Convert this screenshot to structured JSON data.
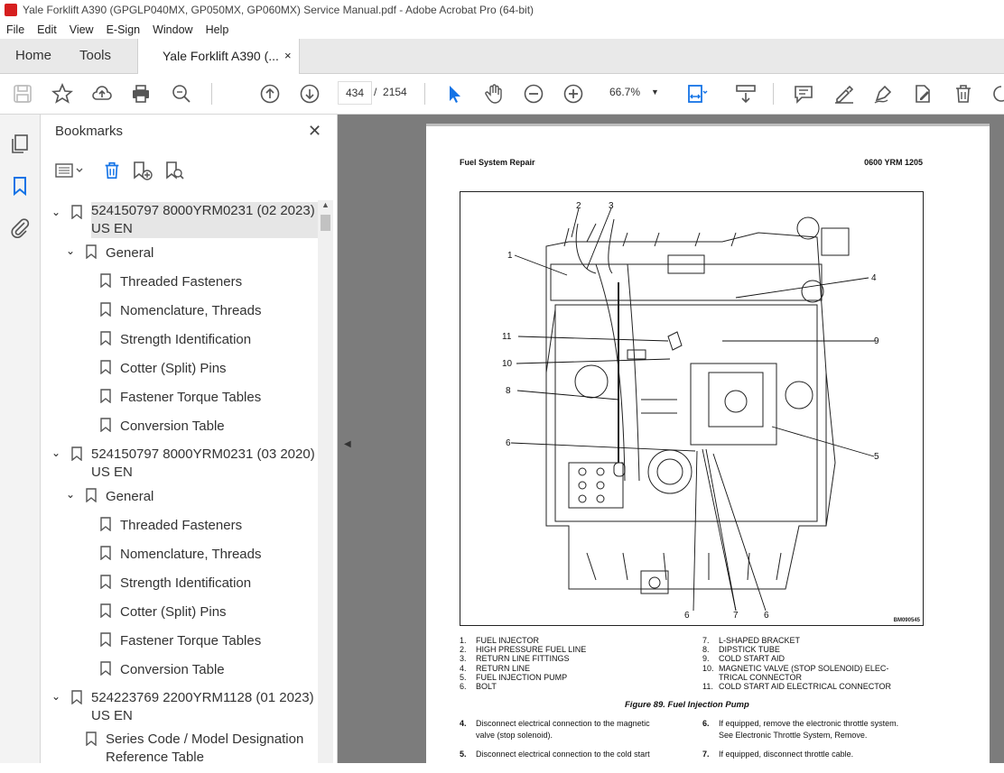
{
  "window": {
    "title": "Yale Forklift A390 (GPGLP040MX, GP050MX, GP060MX) Service Manual.pdf - Adobe Acrobat Pro (64-bit)"
  },
  "menu": [
    "File",
    "Edit",
    "View",
    "E-Sign",
    "Window",
    "Help"
  ],
  "tabs": {
    "home": "Home",
    "tools": "Tools",
    "document": "Yale Forklift A390 (...",
    "close": "×"
  },
  "toolbar": {
    "current_page": "434",
    "page_separator": "/",
    "total_pages": "2154",
    "zoom": "66.7%"
  },
  "bookmarks": {
    "title": "Bookmarks",
    "items": [
      {
        "label": "524150797 8000YRM0231 (02 2023)",
        "label2": "US EN",
        "level": 0
      },
      {
        "label": "General",
        "level": 1
      },
      {
        "label": "Threaded Fasteners",
        "level": 2
      },
      {
        "label": "Nomenclature, Threads",
        "level": 2
      },
      {
        "label": "Strength Identification",
        "level": 2
      },
      {
        "label": "Cotter (Split) Pins",
        "level": 2
      },
      {
        "label": "Fastener Torque Tables",
        "level": 2
      },
      {
        "label": "Conversion Table",
        "level": 2
      },
      {
        "label": "524150797 8000YRM0231 (03 2020)",
        "label2": "US EN",
        "level": 0
      },
      {
        "label": "General",
        "level": 1
      },
      {
        "label": "Threaded Fasteners",
        "level": 2
      },
      {
        "label": "Nomenclature, Threads",
        "level": 2
      },
      {
        "label": "Strength Identification",
        "level": 2
      },
      {
        "label": "Cotter (Split) Pins",
        "level": 2
      },
      {
        "label": "Fastener Torque Tables",
        "level": 2
      },
      {
        "label": "Conversion Table",
        "level": 2
      },
      {
        "label": "524223769 2200YRM1128 (01 2023)",
        "label2": "US EN",
        "level": 0
      },
      {
        "label": "Series Code / Model Designation",
        "label2": "Reference Table",
        "level": 1
      }
    ]
  },
  "document": {
    "header_left": "Fuel System Repair",
    "header_right": "0600 YRM 1205",
    "figure_code": "BM090545",
    "callouts": [
      "1",
      "2",
      "3",
      "4",
      "5",
      "6",
      "7",
      "8",
      "9",
      "10",
      "11"
    ],
    "legend_left": [
      {
        "n": "1.",
        "t": "FUEL INJECTOR"
      },
      {
        "n": "2.",
        "t": "HIGH PRESSURE FUEL LINE"
      },
      {
        "n": "3.",
        "t": "RETURN LINE FITTINGS"
      },
      {
        "n": "4.",
        "t": "RETURN LINE"
      },
      {
        "n": "5.",
        "t": "FUEL INJECTION PUMP"
      },
      {
        "n": "6.",
        "t": "BOLT"
      }
    ],
    "legend_right": [
      {
        "n": "7.",
        "t": "L-SHAPED BRACKET"
      },
      {
        "n": "8.",
        "t": "DIPSTICK TUBE"
      },
      {
        "n": "9.",
        "t": "COLD START AID"
      },
      {
        "n": "10.",
        "t": "MAGNETIC VALVE (STOP SOLENOID) ELEC-"
      },
      {
        "n": "",
        "t": "TRICAL CONNECTOR"
      },
      {
        "n": "11.",
        "t": "COLD START AID ELECTRICAL CONNECTOR"
      }
    ],
    "caption": "Figure 89. Fuel Injection Pump",
    "steps_left": [
      {
        "n": "4.",
        "t1": "Disconnect electrical connection to the magnetic",
        "t2": "valve (stop solenoid)."
      },
      {
        "n": "5.",
        "t1": "Disconnect electrical connection to the cold start",
        "t2": ""
      }
    ],
    "steps_right": [
      {
        "n": "6.",
        "t1": "If equipped, remove the electronic throttle system.",
        "t2": "See Electronic Throttle System, Remove."
      },
      {
        "n": "7.",
        "t1": "If equipped, disconnect throttle cable.",
        "t2": ""
      }
    ]
  },
  "colors": {
    "accent": "#1473e6",
    "app_icon": "#d61f1f",
    "viewer_bg": "#7c7c7c"
  }
}
